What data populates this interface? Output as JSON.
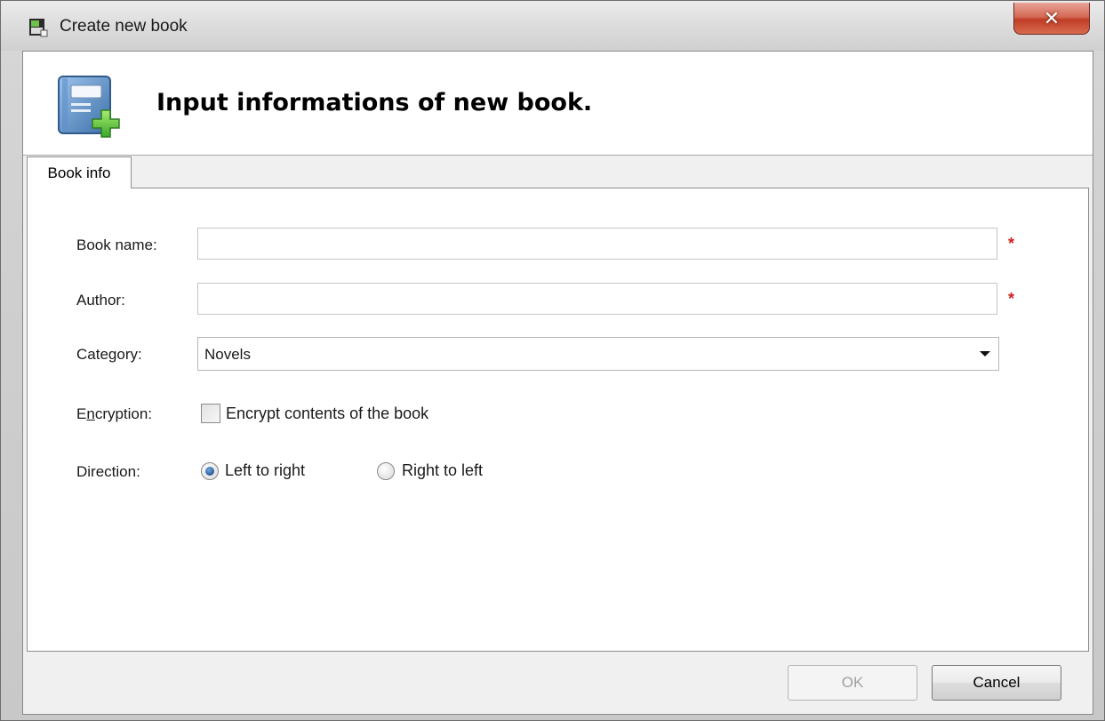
{
  "window": {
    "title": "Create new book",
    "close_glyph": "✕"
  },
  "header": {
    "title": "Input informations of new book.",
    "icon": "book-add-icon"
  },
  "tabs": [
    {
      "label": "Book info",
      "selected": true
    }
  ],
  "form": {
    "book_name": {
      "label": "Book name:",
      "value": "",
      "required_mark": "*"
    },
    "author": {
      "label": "Author:",
      "value": "",
      "required_mark": "*"
    },
    "category": {
      "label": "Category:",
      "value": "Novels"
    },
    "encryption": {
      "label_prefix": "E",
      "label_access": "n",
      "label_rest": "cryption:",
      "checkbox_label": "Encrypt contents of the book",
      "checked": false
    },
    "direction": {
      "label": "Direction:",
      "options": [
        {
          "label": "Left to right",
          "checked": true
        },
        {
          "label": "Right to left",
          "checked": false
        }
      ]
    }
  },
  "buttons": {
    "ok": "OK",
    "cancel": "Cancel"
  },
  "colors": {
    "required": "#d22020",
    "close_button": "#c03d26"
  }
}
